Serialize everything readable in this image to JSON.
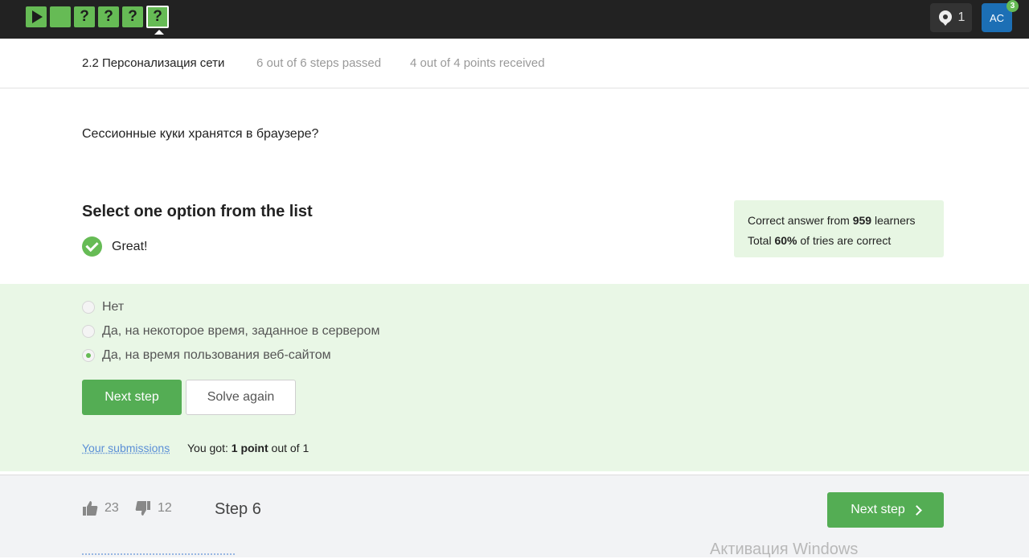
{
  "topbar": {
    "step_marks": [
      "?",
      "?",
      "?",
      "?"
    ],
    "notifications_count": "1",
    "avatar_initials": "AC",
    "avatar_badge": "3"
  },
  "lesson": {
    "title": "2.2 Персонализация сети",
    "steps_passed": "6 out of 6 steps passed",
    "points_received": "4 out of 4 points  received"
  },
  "question": "Сессионные куки хранятся в браузере?",
  "quiz": {
    "heading": "Select one option from the list",
    "feedback": "Great!",
    "stats": {
      "line1_prefix": "Correct answer from ",
      "line1_count": "959",
      "line1_suffix": " learners",
      "line2_prefix": "Total ",
      "line2_percent": "60%",
      "line2_suffix": " of tries are correct"
    },
    "options": [
      {
        "label": "Нет",
        "selected": false
      },
      {
        "label": "Да, на некоторое время, заданное в сервером",
        "selected": false
      },
      {
        "label": "Да, на время пользования веб-сайтом",
        "selected": true
      }
    ],
    "next_step_label": "Next step",
    "solve_again_label": "Solve again",
    "submissions_link": "Your submissions",
    "result_prefix": "You got: ",
    "result_points": "1 point",
    "result_suffix": " out of 1"
  },
  "footer": {
    "likes": "23",
    "dislikes": "12",
    "step_label": "Step 6",
    "next_step_label": "Next step"
  },
  "watermark": "Активация Windows"
}
